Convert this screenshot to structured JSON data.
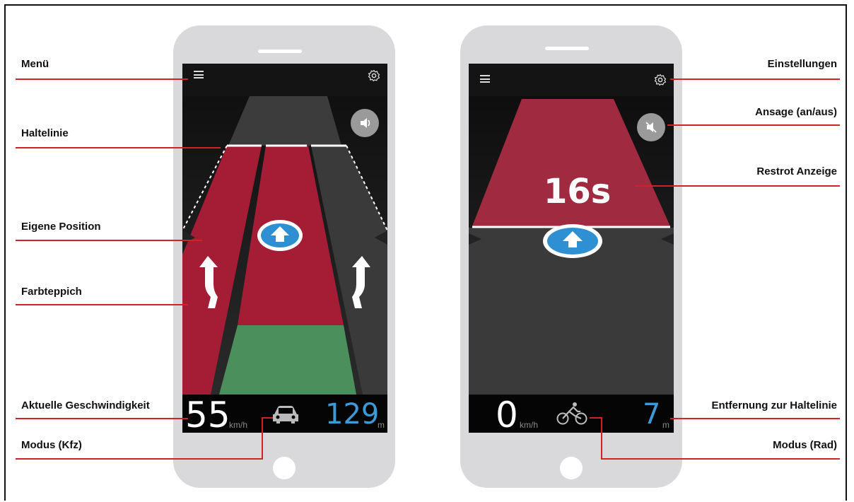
{
  "annotations": {
    "left": {
      "menu": "Menü",
      "stop_line": "Haltelinie",
      "own_position": "Eigene Position",
      "color_carpet": "Farbteppich",
      "current_speed": "Aktuelle Geschwindigkeit",
      "mode_car": "Modus (Kfz)"
    },
    "right": {
      "settings": "Einstellungen",
      "announcement": "Ansage (an/aus)",
      "remaining_red": "Restrot Anzeige",
      "distance": "Entfernung zur Haltelinie",
      "mode_bike": "Modus (Rad)"
    }
  },
  "phone_car": {
    "speed": "55",
    "speed_unit": "km/h",
    "distance": "129",
    "distance_unit": "m",
    "mode_icon": "car-icon",
    "sound_icon": "speaker-on-icon"
  },
  "phone_bike": {
    "speed": "0",
    "speed_unit": "km/h",
    "distance": "7",
    "distance_unit": "m",
    "countdown": "16s",
    "mode_icon": "bicycle-icon",
    "sound_icon": "speaker-muted-icon"
  },
  "colors": {
    "accent_line": "#d32226",
    "lane_red": "#a51d34",
    "lane_green": "#4a8f5c",
    "distance_blue": "#3c9ad8",
    "position_blue": "#2f8fd3"
  }
}
